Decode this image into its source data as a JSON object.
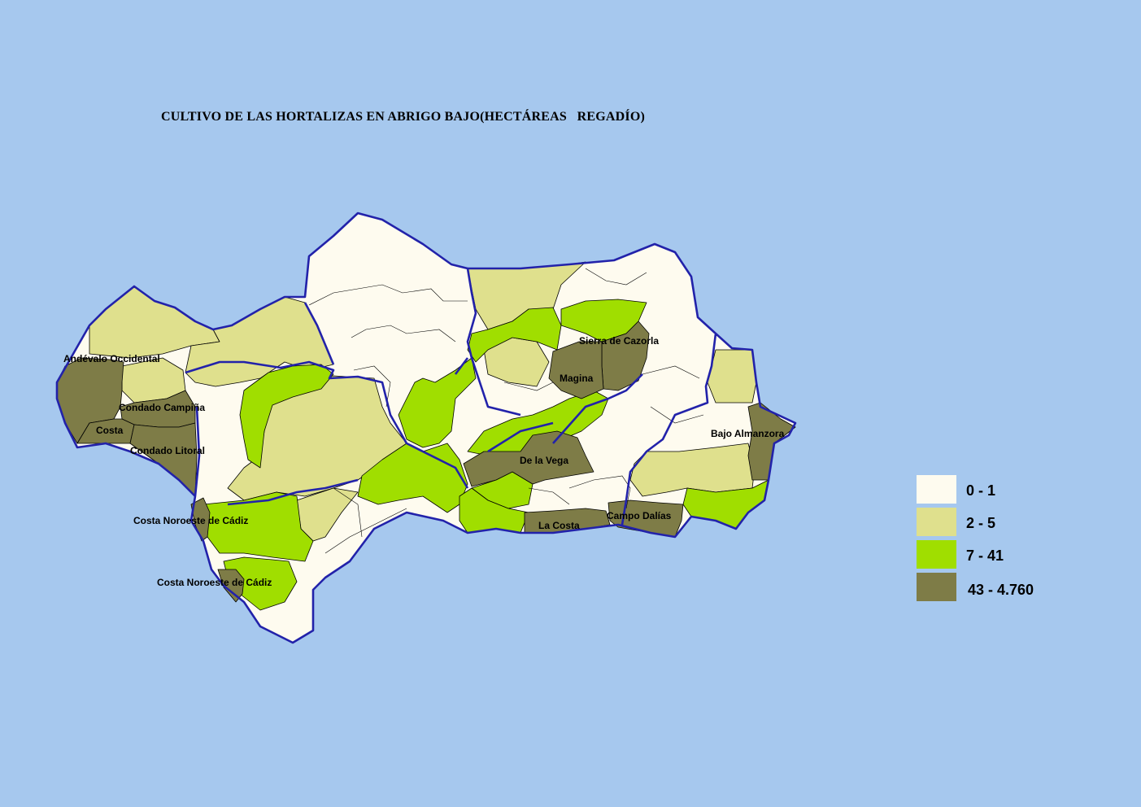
{
  "title": "CULTIVO DE LAS HORTALIZAS EN ABRIGO BAJO(HECTÁREAS   REGADÍO)",
  "colors": {
    "background": "#a6c8ee",
    "class_0_1": "#fefbef",
    "class_2_5": "#dfe08d",
    "class_7_41": "#a0de00",
    "class_43_4760": "#7e7c47",
    "province_border": "#2222aa"
  },
  "legend": [
    {
      "label": "0 - 1",
      "color": "#fefbef"
    },
    {
      "label": "2 - 5",
      "color": "#dfe08d"
    },
    {
      "label": "7 - 41",
      "color": "#a0de00"
    },
    {
      "label": "43 - 4.760",
      "color": "#7e7c47"
    }
  ],
  "labels": {
    "andevalo": "Andévalo Occidental",
    "condado_campina": "Condado Campiña",
    "costa_huelva": "Costa",
    "condado_litoral": "Condado Litoral",
    "costa_noroeste_1": "Costa Noroeste de Cádiz",
    "costa_noroeste_2": "Costa Noroeste de Cádiz",
    "sierra_cazorla": "Sierra de Cazorla",
    "magina": "Magina",
    "de_la_vega": "De la Vega",
    "la_costa": "La Costa",
    "campo_dalias": "Campo Dalías",
    "bajo_almanzora": "Bajo Almanzora"
  }
}
